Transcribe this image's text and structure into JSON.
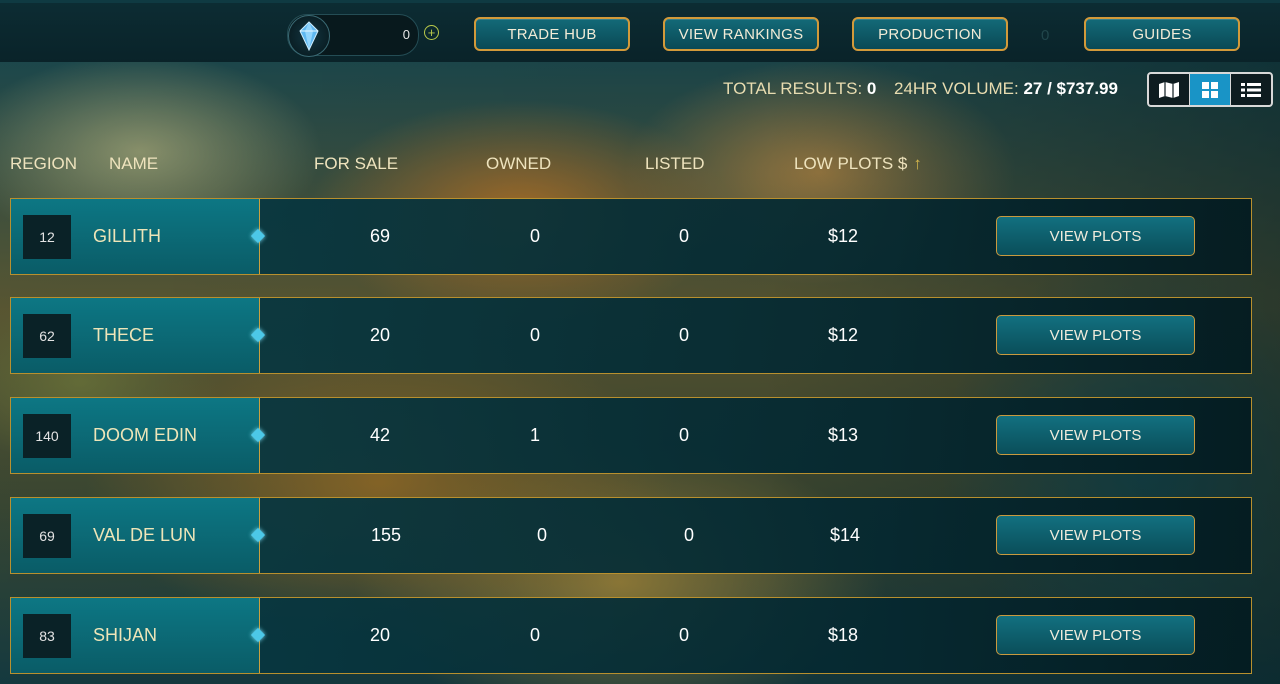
{
  "topbar": {
    "currency": {
      "icon": "crystal-icon",
      "count": "0",
      "add_icon": "+"
    },
    "nav": [
      {
        "label": "TRADE HUB"
      },
      {
        "label": "VIEW RANKINGS"
      },
      {
        "label": "PRODUCTION"
      },
      {
        "label": "GUIDES"
      }
    ],
    "stray_text": "0"
  },
  "summary": {
    "total_results_label": "TOTAL RESULTS:",
    "total_results_value": "0",
    "volume_label": "24HR VOLUME:",
    "volume_value": "27 / $737.99"
  },
  "view_toggle": {
    "options": [
      "map-icon",
      "grid-icon",
      "list-icon"
    ],
    "active": "grid-icon",
    "active_color": "#1994c6"
  },
  "table": {
    "headers": {
      "region": "REGION",
      "name": "NAME",
      "for_sale": "FOR SALE",
      "owned": "OWNED",
      "listed": "LISTED",
      "low_plots": "LOW PLOTS $",
      "sort_indicator": "↑"
    },
    "rows": [
      {
        "region": "12",
        "name": "GILLITH",
        "for_sale": "69",
        "owned": "0",
        "listed": "0",
        "low_plots": "$12",
        "action": "VIEW PLOTS"
      },
      {
        "region": "62",
        "name": "THECE",
        "for_sale": "20",
        "owned": "0",
        "listed": "0",
        "low_plots": "$12",
        "action": "VIEW PLOTS"
      },
      {
        "region": "140",
        "name": "DOOM EDIN",
        "for_sale": "42",
        "owned": "1",
        "listed": "0",
        "low_plots": "$13",
        "action": "VIEW PLOTS"
      },
      {
        "region": "69",
        "name": "VAL DE LUN",
        "for_sale": "155",
        "owned": "0",
        "listed": "0",
        "low_plots": "$14",
        "action": "VIEW PLOTS"
      },
      {
        "region": "83",
        "name": "SHIJAN",
        "for_sale": "20",
        "owned": "0",
        "listed": "0",
        "low_plots": "$18",
        "action": "VIEW PLOTS"
      }
    ]
  },
  "colors": {
    "accent_border": "#d29a3a",
    "button_teal": "#127080",
    "row_teal": "#0d7784"
  }
}
